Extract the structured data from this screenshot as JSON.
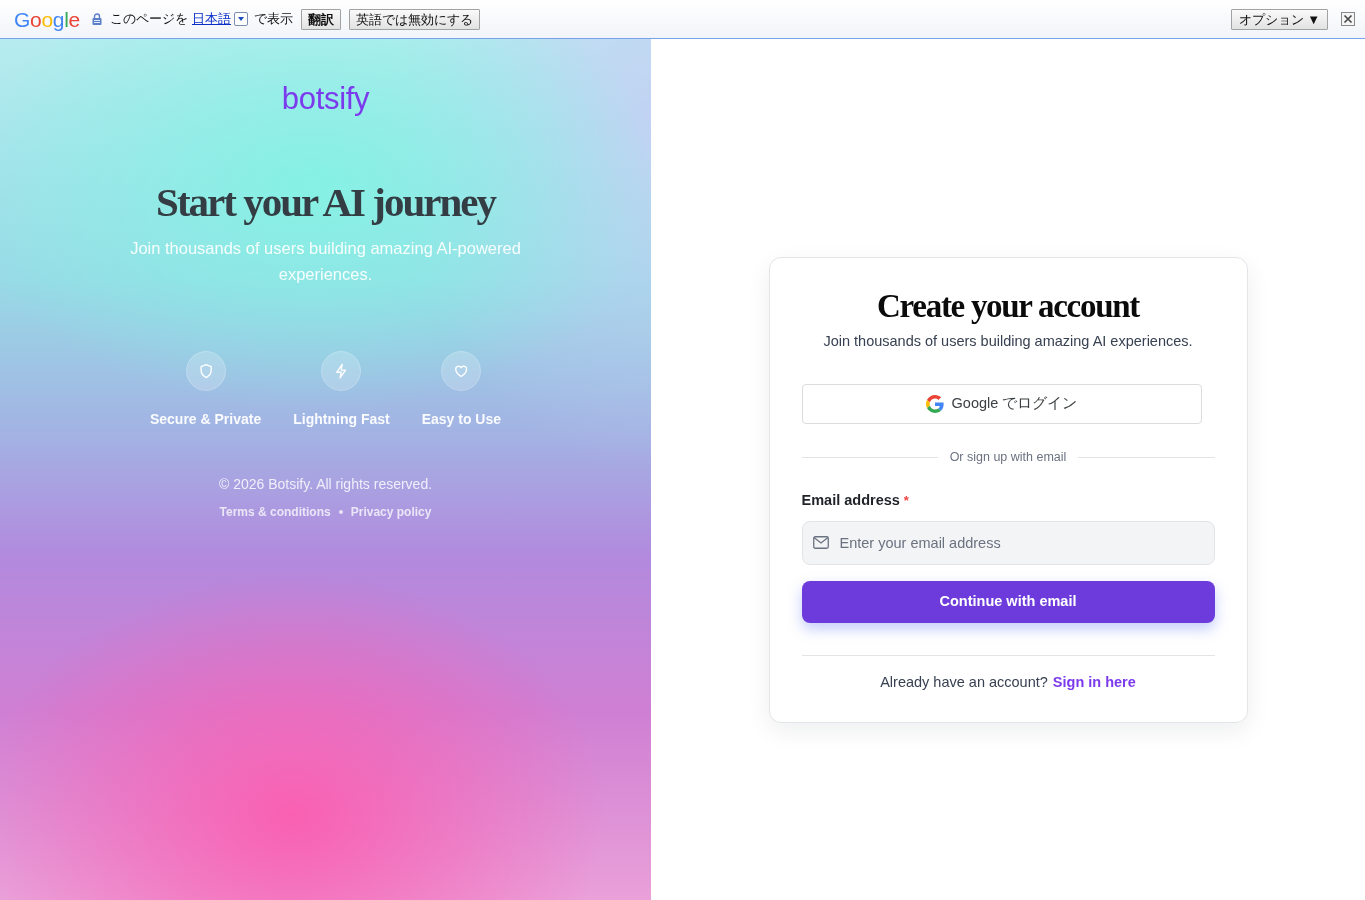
{
  "translate_bar": {
    "logo": "Google",
    "prompt_before": "このページを",
    "language": "日本語",
    "prompt_after": "で表示",
    "buttons": [
      "翻訳",
      "英語では無効にする"
    ],
    "options_button": "オプション ▼"
  },
  "brand_panel": {
    "logo": "botsify",
    "title": "Start your AI journey",
    "subtitle": "Join thousands of users building amazing AI-powered experiences.",
    "features": [
      {
        "kind": "shield",
        "label": "Secure & Private"
      },
      {
        "kind": "bolt",
        "label": "Lightning Fast"
      },
      {
        "kind": "heart",
        "label": "Easy to Use"
      }
    ],
    "copyright": "© 2026 Botsify. All rights reserved.",
    "links": [
      "Terms & conditions",
      "Privacy policy"
    ]
  },
  "signup_card": {
    "title": "Create your account",
    "subtitle": "Join thousands of users building amazing AI experiences.",
    "google_button": "Google でログイン",
    "divider_text": "Or sign up with email",
    "email_field": {
      "label": "Email address",
      "required_mark": "*",
      "placeholder": "Enter your email address"
    },
    "submit_button": "Continue with email",
    "footer": {
      "text": "Already have an account?",
      "link": "Sign in here"
    }
  }
}
